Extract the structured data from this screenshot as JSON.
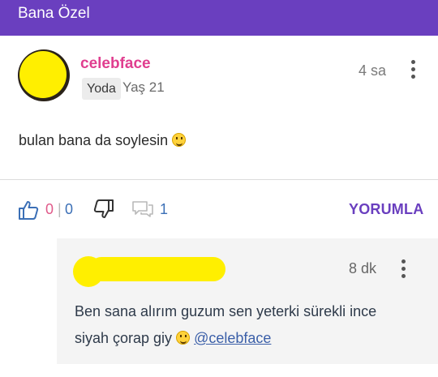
{
  "header": {
    "title": "Bana Özel"
  },
  "post": {
    "username": "celebface",
    "badge": "Yoda",
    "age": "Yaş 21",
    "time": "4 sa",
    "text": "bulan bana da soylesin",
    "emoji": "grinning-face-emoji"
  },
  "actions": {
    "like_count": "0",
    "separator": "|",
    "dislike_count": "0",
    "comment_count": "1",
    "reply_label": "YORUMLA"
  },
  "reply": {
    "time": "8 dk",
    "text_line1": "Ben sana alırım guzum sen yeterki sürekli ince",
    "text_line2": "siyah çorap giy",
    "mention": "@celebface",
    "emoji": "smiling-face-emoji"
  },
  "colors": {
    "brand": "#6a3fbf",
    "username": "#e03e8f",
    "mention": "#3b5fa8",
    "highlight": "#ffef00"
  }
}
